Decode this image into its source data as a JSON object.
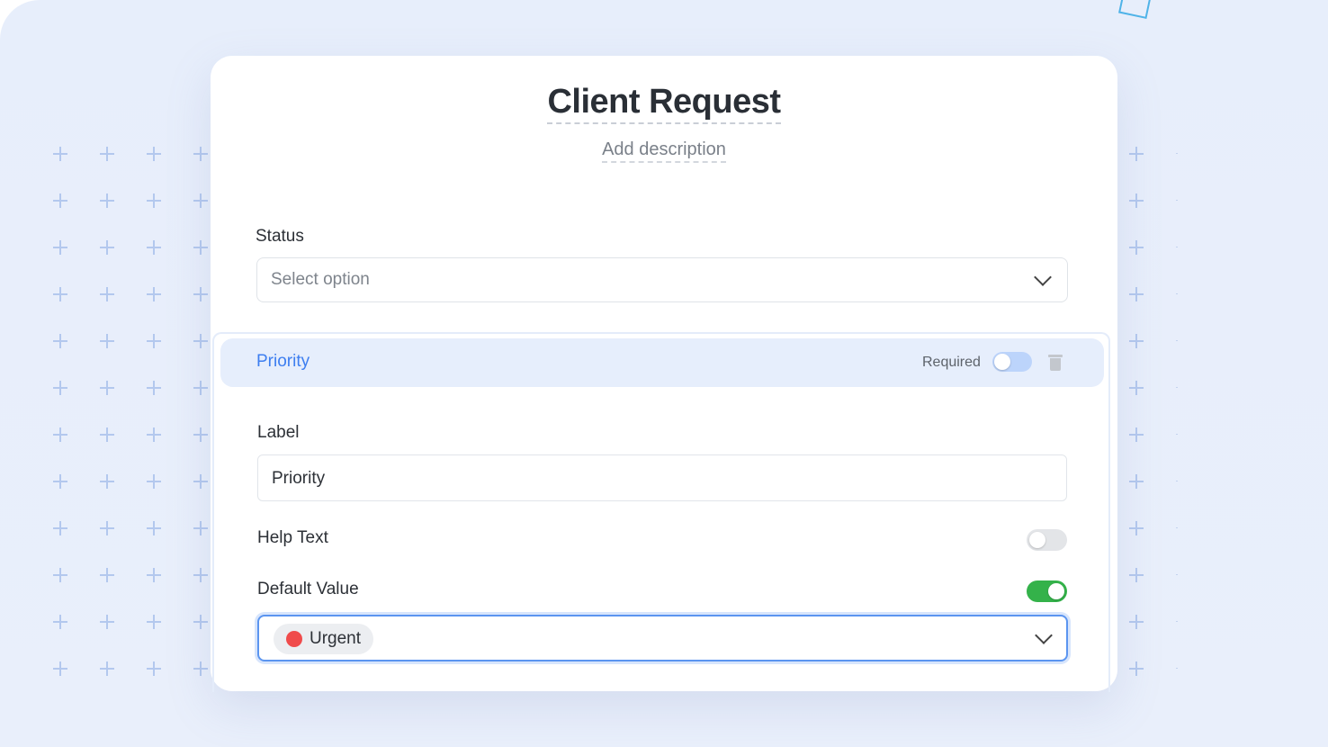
{
  "form": {
    "title": "Client Request",
    "description_placeholder": "Add description"
  },
  "status_field": {
    "label": "Status",
    "placeholder": "Select option"
  },
  "priority_field": {
    "header_title": "Priority",
    "required_label": "Required",
    "required_enabled": false,
    "label_caption": "Label",
    "label_value": "Priority",
    "help_text_caption": "Help Text",
    "help_text_enabled": false,
    "default_value_caption": "Default Value",
    "default_value_enabled": true,
    "default_value_selected": "Urgent",
    "default_value_color": "#f04b4b"
  },
  "colors": {
    "accent": "#3d7ef0",
    "toggle_on": "#34b24a",
    "toggle_off": "#e3e5e8",
    "toggle_required_off": "#bcd4fb"
  },
  "icons": {
    "status_dropdown": "chevron-down-icon",
    "delete": "trash-icon",
    "default_dropdown": "chevron-down-icon"
  }
}
